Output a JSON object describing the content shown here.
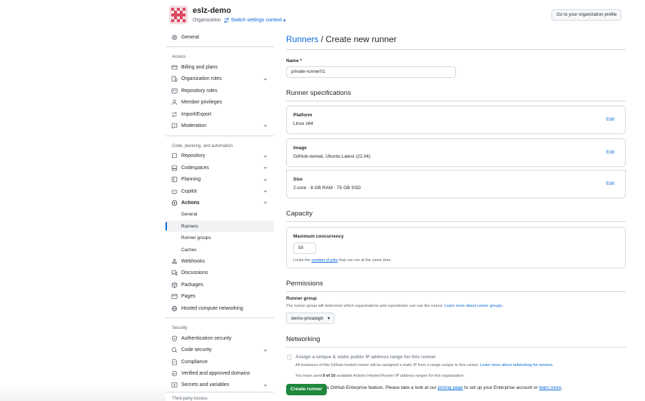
{
  "header": {
    "org_name": "eslz-demo",
    "org_type": "Organization",
    "switch_label": "Switch settings context",
    "profile_button": "Go to your organization profile"
  },
  "sidebar": {
    "general": "General",
    "access_heading": "Access",
    "access_items": [
      "Billing and plans",
      "Organization roles",
      "Repository roles",
      "Member privileges",
      "Import/Export",
      "Moderation"
    ],
    "code_heading": "Code, planning, and automation",
    "code_items": [
      "Repository",
      "Codespaces",
      "Planning",
      "Copilot",
      "Actions"
    ],
    "actions_sub": [
      "General",
      "Runners",
      "Runner groups",
      "Caches"
    ],
    "more_items": [
      "Webhooks",
      "Discussions",
      "Packages",
      "Pages",
      "Hosted compute networking"
    ],
    "security_heading": "Security",
    "security_items": [
      "Authentication security",
      "Code security",
      "Compliance",
      "Verified and approved domains",
      "Secrets and variables"
    ],
    "next_heading": "Third-party Access"
  },
  "main": {
    "breadcrumb": "Runners",
    "title_rest": " / Create new runner",
    "name_label": "Name *",
    "name_value": "private-runner01",
    "specs_title": "Runner specifications",
    "edit_label": "Edit",
    "specs": [
      {
        "title": "Platform",
        "value": "Linux x64"
      },
      {
        "title": "Image",
        "value": "GitHub-owned, Ubuntu Latest (22.04)"
      },
      {
        "title": "Size",
        "value": "2-core · 8 GB RAM · 75 GB SSD"
      }
    ],
    "capacity_title": "Capacity",
    "concurrency_label": "Maximum concurrency",
    "concurrency_value": "50",
    "concurrency_help_pre": "Limits the ",
    "concurrency_help_link": "number of jobs",
    "concurrency_help_post": " that can run at the same time.",
    "permissions_title": "Permissions",
    "runner_group_label": "Runner group",
    "runner_group_help": "The runner group will determine which organizations and repositories can use the runner. ",
    "runner_group_link": "Learn more about runner groups.",
    "runner_group_value": "demo-privategh",
    "networking_title": "Networking",
    "static_ip_label": "Assign a unique & static public IP address range for this runner",
    "static_ip_help": "All instances of this GitHub-hosted runner will be assigned a static IP from a range unique to this runner. ",
    "static_ip_link": "Learn more about networking for runners.",
    "used_pre": "You have used ",
    "used_count": "0 of 10",
    "used_post": " available Actions Hosted Runner IP address ranges for this organization.",
    "note_pre": "Static IP is a GitHub Enterprise feature. Please take a look at our ",
    "note_link1": "pricing page",
    "note_mid": " to set up your Enterprise account or ",
    "note_link2": "learn more",
    "note_post": ".",
    "create_button": "Create runner"
  }
}
